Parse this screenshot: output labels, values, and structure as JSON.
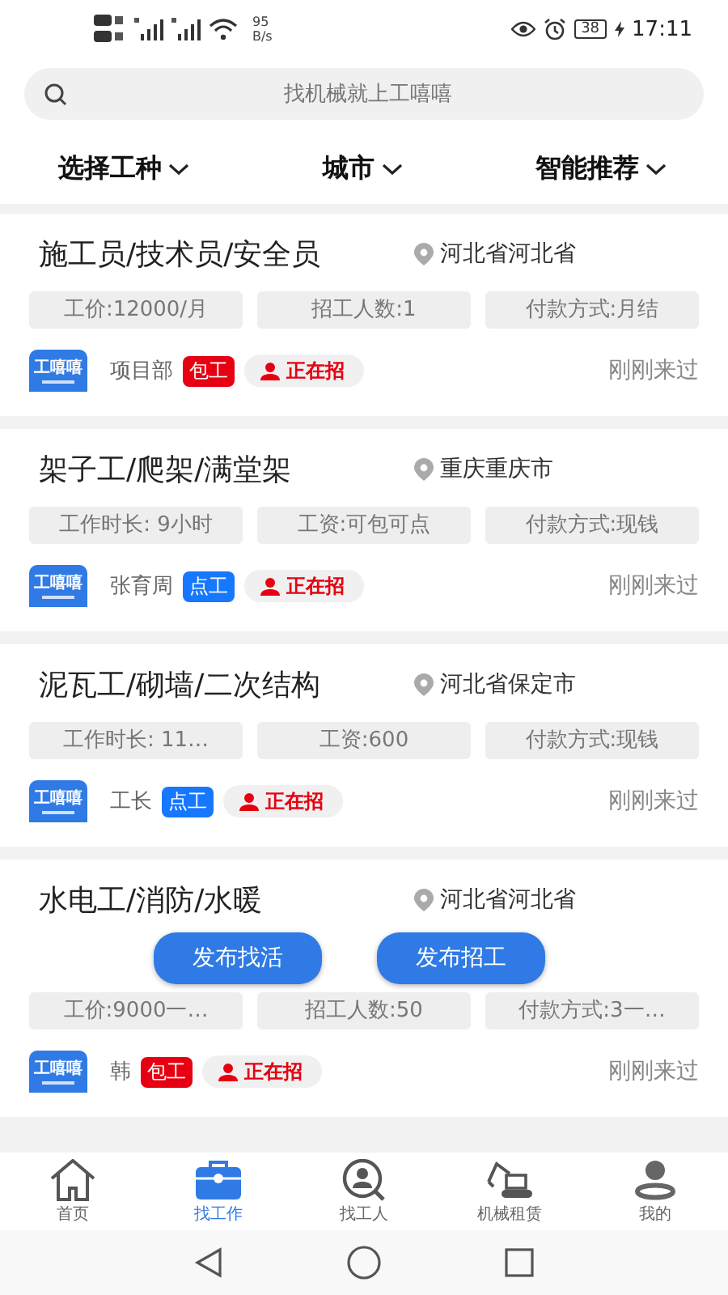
{
  "status_bar": {
    "speed_value": "95",
    "speed_unit": "B/s",
    "battery": "38",
    "time": "17:11"
  },
  "search": {
    "placeholder": "找机械就上工嘻嘻"
  },
  "filters": [
    {
      "label": "选择工种"
    },
    {
      "label": "城市"
    },
    {
      "label": "智能推荐"
    }
  ],
  "jobs": [
    {
      "title": "施工员/技术员/安全员",
      "location": "河北省河北省",
      "chips": [
        "工价:12000/月",
        "招工人数:1",
        "付款方式:月结"
      ],
      "logo_text": "工嘻嘻",
      "poster": "项目部",
      "tag": {
        "label": "包工",
        "color": "#e60012"
      },
      "status": "正在招",
      "time": "刚刚来过"
    },
    {
      "title": "架子工/爬架/满堂架",
      "location": "重庆重庆市",
      "chips": [
        "工作时长: 9小时",
        "工资:可包可点",
        "付款方式:现钱"
      ],
      "logo_text": "工嘻嘻",
      "poster": "张育周",
      "tag": {
        "label": "点工",
        "color": "#1677ff"
      },
      "status": "正在招",
      "time": "刚刚来过"
    },
    {
      "title": "泥瓦工/砌墙/二次结构",
      "location": "河北省保定市",
      "chips": [
        "工作时长: 11…",
        "工资:600",
        "付款方式:现钱"
      ],
      "logo_text": "工嘻嘻",
      "poster": "工长",
      "tag": {
        "label": "点工",
        "color": "#1677ff"
      },
      "status": "正在招",
      "time": "刚刚来过"
    },
    {
      "title": "水电工/消防/水暖",
      "location": "河北省河北省",
      "chips": [
        "工价:9000一…",
        "招工人数:50",
        "付款方式:3一…"
      ],
      "logo_text": "工嘻嘻",
      "poster": "韩",
      "tag": {
        "label": "包工",
        "color": "#e60012"
      },
      "status": "正在招",
      "time": "刚刚来过"
    }
  ],
  "float_buttons": [
    "发布找活",
    "发布招工"
  ],
  "tabs": [
    {
      "label": "首页",
      "selected": false
    },
    {
      "label": "找工作",
      "selected": true
    },
    {
      "label": "找工人",
      "selected": false
    },
    {
      "label": "机械租赁",
      "selected": false
    },
    {
      "label": "我的",
      "selected": false
    }
  ]
}
